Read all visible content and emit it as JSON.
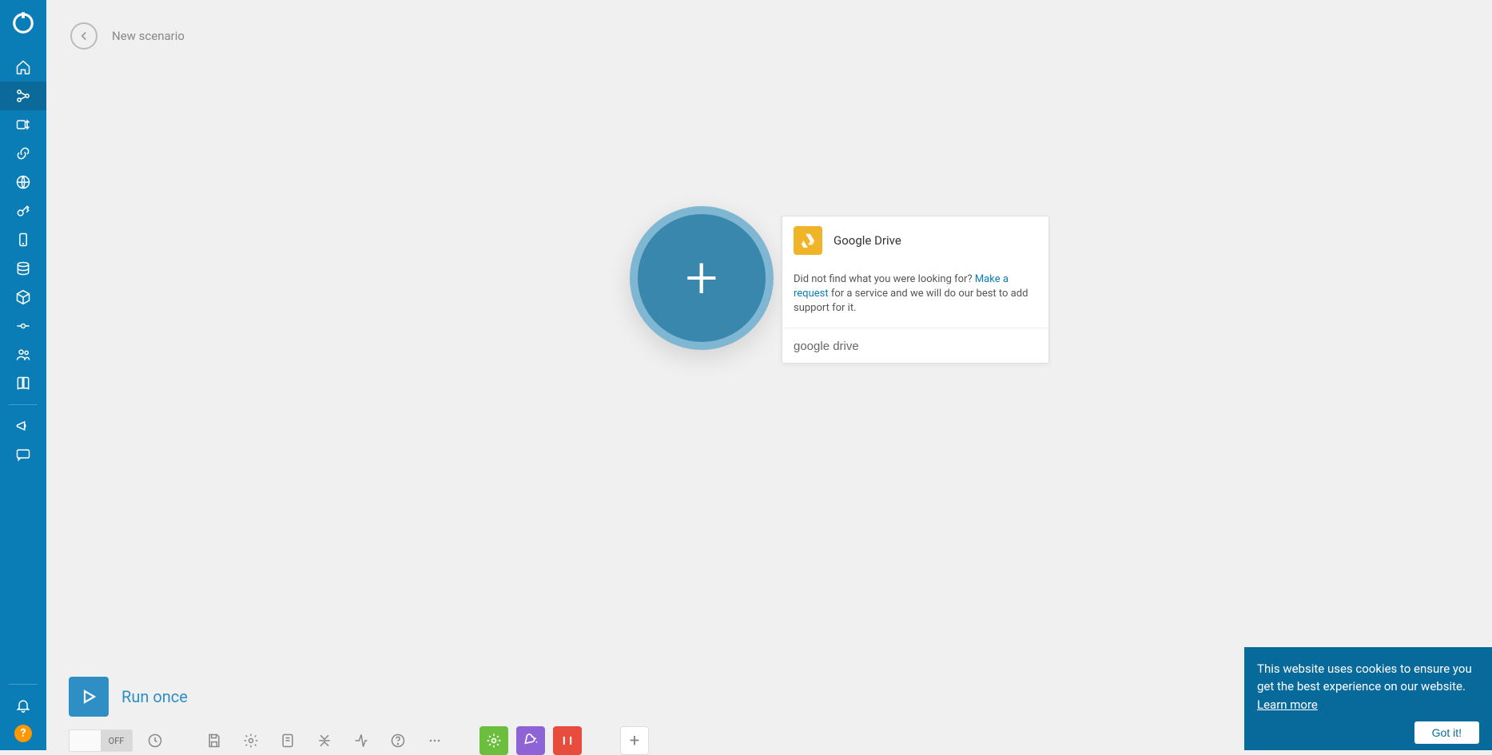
{
  "scenario": {
    "title": "New scenario"
  },
  "run": {
    "label": "Run once"
  },
  "toggle": {
    "on": "",
    "off": "OFF"
  },
  "servicePanel": {
    "result": {
      "name": "Google Drive"
    },
    "message_before": "Did not find what you were looking for? ",
    "message_link": "Make a request",
    "message_after": " for a service and we will do our best to add support for it.",
    "search_value": "google drive"
  },
  "cookie": {
    "text_before": "This website uses cookies to ensure you get the best experience on our website. ",
    "learn_more": "Learn more",
    "button": "Got it!"
  },
  "sidebar": {
    "help": "?"
  }
}
